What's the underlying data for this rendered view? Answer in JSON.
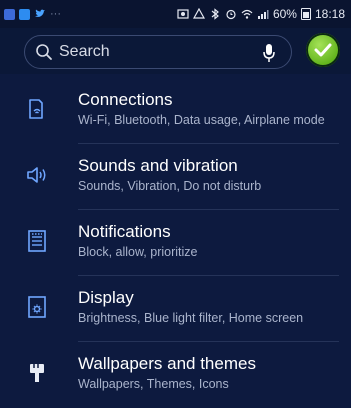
{
  "status_bar": {
    "battery_text": "60%",
    "time": "18:18"
  },
  "search": {
    "placeholder": "Search"
  },
  "colors": {
    "background": "#0d1a3f",
    "accent_icon": "#6fa6ff",
    "check_green": "#6cc025"
  },
  "settings": [
    {
      "title": "Connections",
      "subtitle": "Wi-Fi, Bluetooth, Data usage, Airplane mode",
      "icon": "connections-icon"
    },
    {
      "title": "Sounds and vibration",
      "subtitle": "Sounds, Vibration, Do not disturb",
      "icon": "sound-icon"
    },
    {
      "title": "Notifications",
      "subtitle": "Block, allow, prioritize",
      "icon": "notifications-icon"
    },
    {
      "title": "Display",
      "subtitle": "Brightness, Blue light filter, Home screen",
      "icon": "display-icon"
    },
    {
      "title": "Wallpapers and themes",
      "subtitle": "Wallpapers, Themes, Icons",
      "icon": "brush-icon"
    }
  ]
}
